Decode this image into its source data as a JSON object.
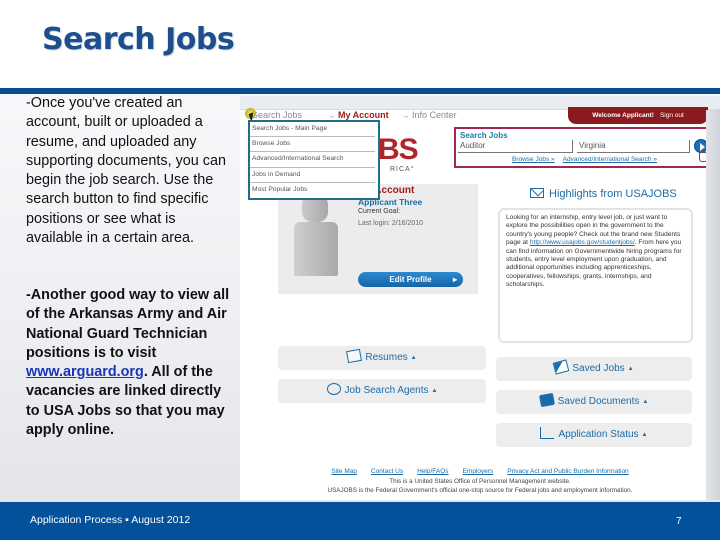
{
  "slide": {
    "title": "Search Jobs",
    "paragraph1": "-Once you've created an account, built or uploaded a resume, and uploaded any supporting documents, you can begin the job search. Use the search button to find specific positions or see what is available in a certain area.",
    "paragraph2_before_link": "-Another good way to view all of the Arkansas Army and Air National Guard Technician positions is to visit ",
    "paragraph2_link": "www.arguard.org",
    "paragraph2_after_link": ".  All of the vacancies are linked directly to USA Jobs so that you may apply online.",
    "footer": "Application Process  ▪ August 2012",
    "page_number": "7"
  },
  "site": {
    "nav": {
      "search_jobs": "Search Jobs",
      "my_account": "My Account",
      "info_center": "Info Center",
      "arrow": "→"
    },
    "welcome": "Welcome Applicant!",
    "sign_out": "Sign out",
    "logo_text": "BS",
    "logo_sub": "RICA°",
    "search_box": {
      "title": "Search Jobs",
      "what_value": "Auditor",
      "where_value": "Virginia",
      "browse_link": "Browse Jobs »",
      "advanced_link": "Advanced/International Search »"
    },
    "dropdown": [
      "Search Jobs - Main Page",
      "Browse Jobs",
      "Advanced/International Search",
      "Jobs in Demand",
      "Most Popular Jobs"
    ],
    "account": {
      "title": "My Account",
      "name": "Applicant Three",
      "goal": "Current Goal:",
      "last_login": "Last login: 2/16/2010",
      "edit_profile": "Edit Profile"
    },
    "highlights": {
      "title": "Highlights from USAJOBS",
      "text_before_link": "Looking for an internship, entry level job, or just want to explore the possibilities open in the government to the country's young people? Check out the brand new Students page at ",
      "link": "http://www.usajobs.gov/studentjobs/",
      "text_after_link": ". From here you can find information on Governmentwide hiring programs for students, entry level employment upon graduation, and additional opportunities including apprenticeships, cooperatives, fellowships, grants, internships, and scholarships."
    },
    "panels": {
      "resumes": "Resumes",
      "job_search_agents": "Job Search Agents",
      "saved_jobs": "Saved Jobs",
      "saved_documents": "Saved Documents",
      "application_status": "Application Status",
      "caret": "▲"
    },
    "footer_links": [
      "Site Map",
      "Contact Us",
      "Help/FAQs",
      "Employers",
      "Privacy Act and Public Burden Information"
    ],
    "footer_line1": "This is a United States Office of Personnel Management website.",
    "footer_line2": "USAJOBS is the Federal Government's official one-stop source for Federal jobs and employment information."
  }
}
